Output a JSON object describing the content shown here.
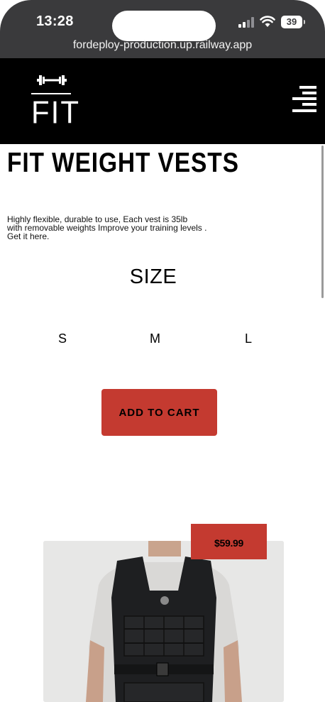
{
  "status_bar": {
    "time": "13:28",
    "battery": "39",
    "icons": [
      "signal-icon",
      "wifi-icon",
      "battery-icon"
    ]
  },
  "browser": {
    "url": "fordeploy-production.up.railway.app"
  },
  "header": {
    "logo_text": "FIT",
    "logo_icon": "dumbbell-icon",
    "menu_icon": "hamburger-menu-icon",
    "background": "#000000"
  },
  "product": {
    "title": "FIT WEIGHT VESTS",
    "description_lines": [
      "Highly flexible, durable to use, Each vest is 35lb",
      "with removable weights Improve your training levels .",
      "Get it here."
    ],
    "size_heading": "SIZE",
    "sizes": [
      "S",
      "M",
      "L"
    ],
    "add_to_cart_label": "ADD TO CART",
    "price": "$59.99",
    "accent_color": "#c43a30"
  }
}
